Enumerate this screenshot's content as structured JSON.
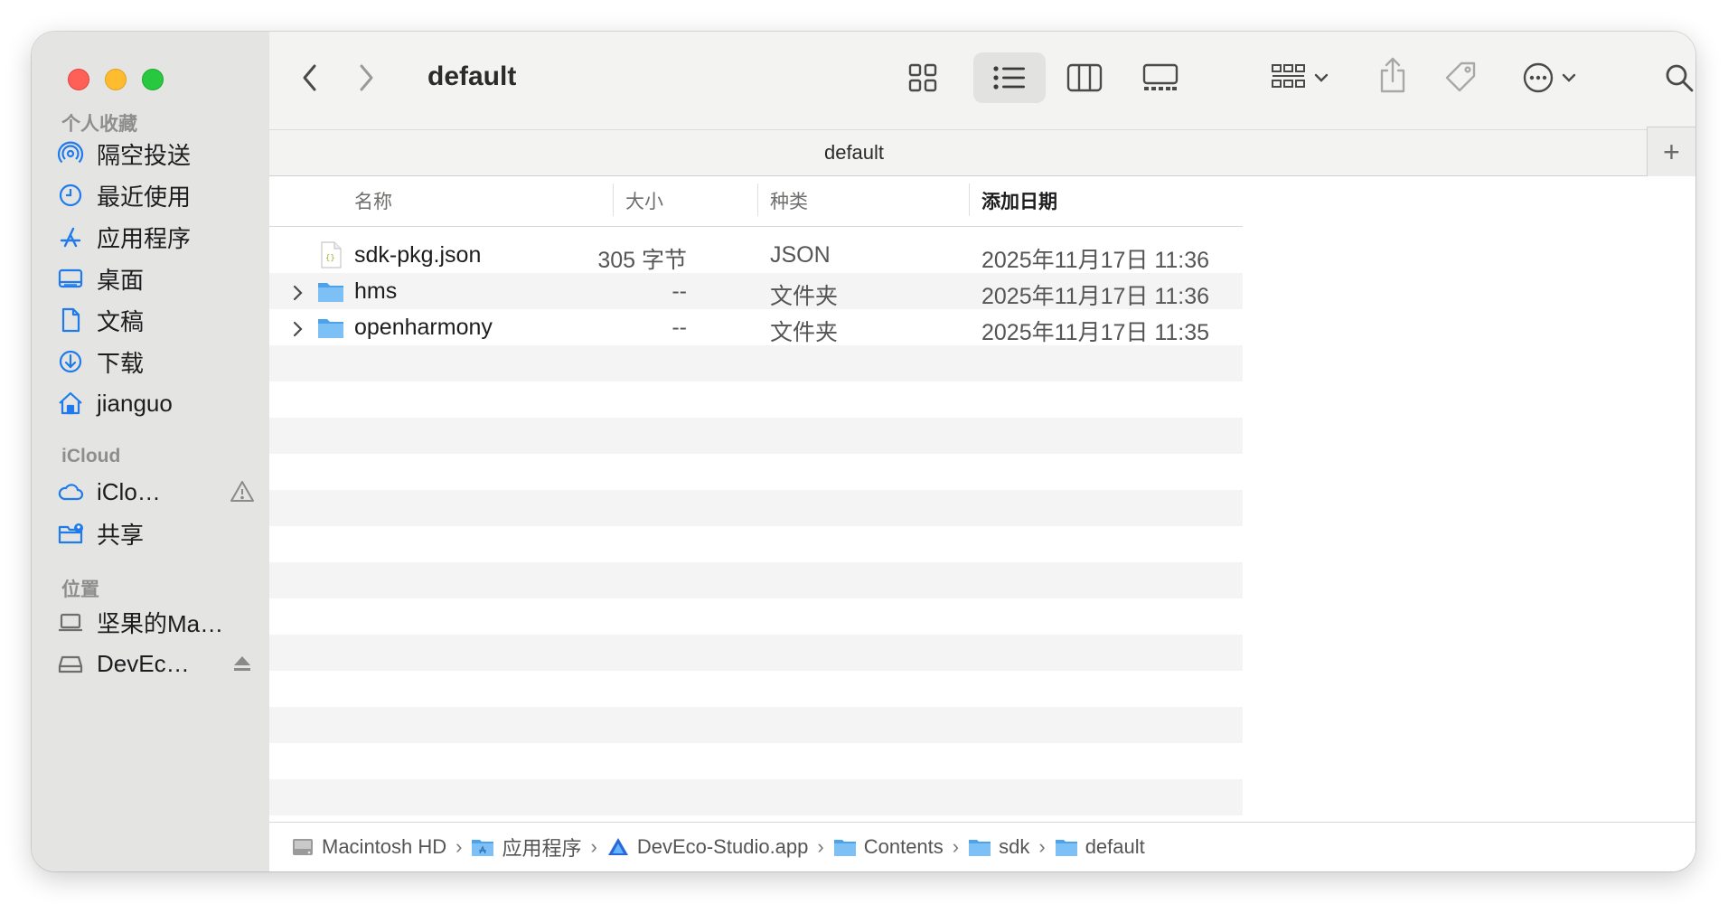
{
  "window": {
    "title": "default",
    "tab_title": "default"
  },
  "sidebar": {
    "favorites_title": "个人收藏",
    "favorites": [
      {
        "label": "隔空投送",
        "icon": "airdrop-icon"
      },
      {
        "label": "最近使用",
        "icon": "clock-icon"
      },
      {
        "label": "应用程序",
        "icon": "applications-icon"
      },
      {
        "label": "桌面",
        "icon": "desktop-icon"
      },
      {
        "label": "文稿",
        "icon": "document-icon"
      },
      {
        "label": "下载",
        "icon": "download-icon"
      },
      {
        "label": "jianguo",
        "icon": "home-icon"
      }
    ],
    "icloud_title": "iCloud",
    "icloud": [
      {
        "label": "iClo…",
        "icon": "cloud-icon"
      },
      {
        "label": "共享",
        "icon": "shared-folder-icon"
      }
    ],
    "locations_title": "位置",
    "locations": [
      {
        "label": "坚果的Ma…",
        "icon": "laptop-icon"
      },
      {
        "label": "DevEc…",
        "icon": "disk-icon"
      }
    ]
  },
  "list": {
    "headers": {
      "name": "名称",
      "size": "大小",
      "kind": "种类",
      "date": "添加日期"
    },
    "rows": [
      {
        "name": "sdk-pkg.json",
        "size": "305 字节",
        "kind": "JSON",
        "date": "2025年11月17日 11:36",
        "type": "json-file"
      },
      {
        "name": "hms",
        "size": "--",
        "kind": "文件夹",
        "date": "2025年11月17日 11:36",
        "type": "folder"
      },
      {
        "name": "openharmony",
        "size": "--",
        "kind": "文件夹",
        "date": "2025年11月17日 11:35",
        "type": "folder"
      }
    ]
  },
  "pathbar": {
    "crumbs": [
      {
        "label": "Macintosh HD",
        "icon": "hard-drive-icon"
      },
      {
        "label": "应用程序",
        "icon": "applications-folder-icon"
      },
      {
        "label": "DevEco-Studio.app",
        "icon": "deveco-app-icon"
      },
      {
        "label": "Contents",
        "icon": "folder-icon"
      },
      {
        "label": "sdk",
        "icon": "folder-icon"
      },
      {
        "label": "default",
        "icon": "folder-icon"
      }
    ]
  },
  "colors": {
    "accent": "#1f7aec",
    "folder": "#5aaef0",
    "close": "#fe5f57",
    "minimize": "#febc2e",
    "maximize": "#28c840"
  }
}
